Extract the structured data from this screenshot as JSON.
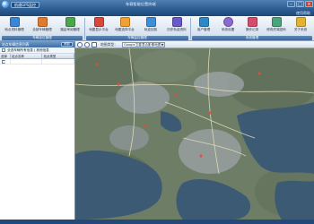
{
  "app": {
    "title": "车载智能位置终端",
    "badge": "航通GPS监控",
    "colors": {
      "titlebar": "#2c5a8d",
      "ribbon": "#dbe5f0",
      "accent": "#3e6ea3",
      "close": "#c8432f"
    }
  },
  "window_controls": {
    "minimize": "–",
    "maximize": "□",
    "close": "×"
  },
  "menu": {
    "help": "使用帮助"
  },
  "toolbar": {
    "groups": [
      {
        "label": "车辆定位管理",
        "tools": [
          {
            "label": "地点资料管理",
            "icon": "globe-icon",
            "color": "#3a86d8"
          },
          {
            "label": "全部车辆管理",
            "icon": "car-icon",
            "color": "#e07a2f"
          },
          {
            "label": "路由审阅管理",
            "icon": "route-icon",
            "color": "#4aa84a"
          }
        ]
      },
      {
        "label": "车辆监控管理",
        "tools": [
          {
            "label": "地图显示平台",
            "icon": "map-icon",
            "color": "#d9463b"
          },
          {
            "label": "地图选择平台",
            "icon": "rss-icon",
            "color": "#f2a12e"
          },
          {
            "label": "轨迹回放",
            "icon": "track-icon",
            "color": "#3b8fd8"
          },
          {
            "label": "历史轨迹资料",
            "icon": "history-icon",
            "color": "#6a59c9"
          }
        ]
      },
      {
        "label": "系统管理",
        "tools": [
          {
            "label": "用户管理",
            "icon": "user-icon",
            "color": "#2d88c8"
          },
          {
            "label": "系统设置",
            "icon": "clock-icon",
            "color": "#8c6ad0"
          },
          {
            "label": "操作记录",
            "icon": "calendar-icon",
            "color": "#d44b6d"
          },
          {
            "label": "修改终端密码",
            "icon": "database-icon",
            "color": "#4aa37b"
          },
          {
            "label": "关于系统",
            "icon": "help-icon",
            "color": "#e3b22e"
          }
        ]
      }
    ]
  },
  "left_panel": {
    "title": "站点车辆信息列表",
    "refresh_label": "刷新",
    "filter": "全选车辆所有信息 | 其他信息",
    "columns": [
      "选择",
      "站点名称",
      "站点类型"
    ],
    "rows": [
      {
        "name": "",
        "type": ""
      }
    ]
  },
  "map": {
    "type_label": "地图类型：",
    "type_value": "Google卫星混合影像地图"
  }
}
